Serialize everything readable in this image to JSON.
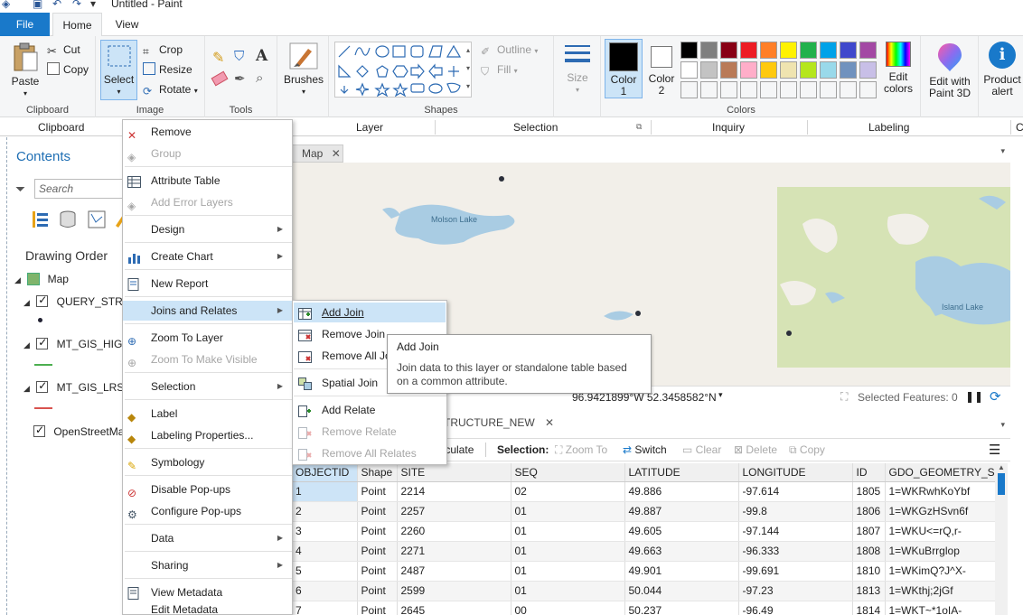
{
  "paint": {
    "window_title": "Untitled - Paint",
    "tabs": {
      "file": "File",
      "home": "Home",
      "view": "View"
    },
    "groups": {
      "clipboard": "Clipboard",
      "image": "Image",
      "tools": "Tools",
      "shapes": "Shapes",
      "colors": "Colors"
    },
    "buttons": {
      "paste": "Paste",
      "cut": "Cut",
      "copy": "Copy",
      "select": "Select",
      "crop": "Crop",
      "resize": "Resize",
      "rotate": "Rotate",
      "brushes": "Brushes",
      "outline": "Outline",
      "fill": "Fill",
      "size": "Size",
      "color1_a": "Color",
      "color1_b": "1",
      "color2_a": "Color",
      "color2_b": "2",
      "edit_colors_a": "Edit",
      "edit_colors_b": "colors",
      "edit_3d_a": "Edit with",
      "edit_3d_b": "Paint 3D",
      "product_alert_a": "Product",
      "product_alert_b": "alert"
    },
    "palette_row1": [
      "#000000",
      "#7f7f7f",
      "#880015",
      "#ed1c24",
      "#ff7f27",
      "#fff200",
      "#22b14c",
      "#00a2e8",
      "#3f48cc",
      "#a349a4"
    ],
    "palette_row2": [
      "#ffffff",
      "#c3c3c3",
      "#b97a57",
      "#ffaec9",
      "#ffc90e",
      "#efe4b0",
      "#b5e61d",
      "#99d9ea",
      "#7092be",
      "#c8bfe7"
    ],
    "palette_row3_count": 10
  },
  "gis": {
    "ribbon_labels": {
      "clipboard": "Clipboard",
      "layer": "Layer",
      "selection": "Selection",
      "inquiry": "Inquiry",
      "labeling": "Labeling"
    },
    "contents": {
      "title": "Contents",
      "search_placeholder": "Search",
      "drawing_order": "Drawing Order",
      "map": "Map",
      "layers": [
        "QUERY_STRUC",
        "MT_GIS_HIGHV",
        "MT_GIS_LRS_H",
        "OpenStreetMap"
      ]
    },
    "map": {
      "tab": "Map",
      "labels": {
        "molson": "Molson Lake",
        "island": "Island Lake"
      },
      "coordinates": "96.9421899°W 52.3458582°N",
      "selected_features": "Selected Features: 0"
    },
    "table": {
      "tab": "STRUCTURE_NEW",
      "toolbar": {
        "calculate": "alculate",
        "selection": "Selection:",
        "zoom_to": "Zoom To",
        "switch": "Switch",
        "clear": "Clear",
        "delete": "Delete",
        "copy": "Copy"
      },
      "columns": [
        "OBJECTID",
        "Shape",
        "SITE",
        "SEQ",
        "LATITUDE",
        "LONGITUDE",
        "ID",
        "GDO_GEOMETRY_SK"
      ],
      "rows": [
        [
          "1",
          "Point",
          "2214",
          "02",
          "49.886",
          "-97.614",
          "1805",
          "1=WKRwhKoYbf"
        ],
        [
          "2",
          "Point",
          "2257",
          "01",
          "49.887",
          "-99.8",
          "1806",
          "1=WKGzHSvn6f"
        ],
        [
          "3",
          "Point",
          "2260",
          "01",
          "49.605",
          "-97.144",
          "1807",
          "1=WKU<=rQ,r-"
        ],
        [
          "4",
          "Point",
          "2271",
          "01",
          "49.663",
          "-96.333",
          "1808",
          "1=WKuBrrglop"
        ],
        [
          "5",
          "Point",
          "2487",
          "01",
          "49.901",
          "-99.691",
          "1810",
          "1=WKimQ?J^X-"
        ],
        [
          "6",
          "Point",
          "2599",
          "01",
          "50.044",
          "-97.23",
          "1813",
          "1=WKthj;2jGf"
        ],
        [
          "7",
          "Point",
          "2645",
          "00",
          "50.237",
          "-96.49",
          "1814",
          "1=WKT~*1oIA-"
        ]
      ]
    },
    "context_menu": {
      "remove": "Remove",
      "group": "Group",
      "attribute_table": "Attribute Table",
      "add_error_layers": "Add Error Layers",
      "design": "Design",
      "create_chart": "Create Chart",
      "new_report": "New Report",
      "joins_and_relates": "Joins and Relates",
      "zoom_to_layer": "Zoom To Layer",
      "zoom_to_make_visible": "Zoom To Make Visible",
      "selection": "Selection",
      "label": "Label",
      "labeling_properties": "Labeling Properties...",
      "symbology": "Symbology",
      "disable_popups": "Disable Pop-ups",
      "configure_popups": "Configure Pop-ups",
      "data": "Data",
      "sharing": "Sharing",
      "view_metadata": "View Metadata",
      "edit_metadata": "Edit Metadata"
    },
    "submenu": {
      "add_join": "Add Join",
      "remove_join": "Remove Join",
      "remove_all_joins": "Remove All Joins",
      "spatial_join": "Spatial Join",
      "add_relate": "Add Relate",
      "remove_relate": "Remove Relate",
      "remove_all_relates": "Remove All Relates"
    },
    "tooltip": {
      "title": "Add Join",
      "body": "Join data to this layer or standalone table based on a common attribute."
    }
  }
}
